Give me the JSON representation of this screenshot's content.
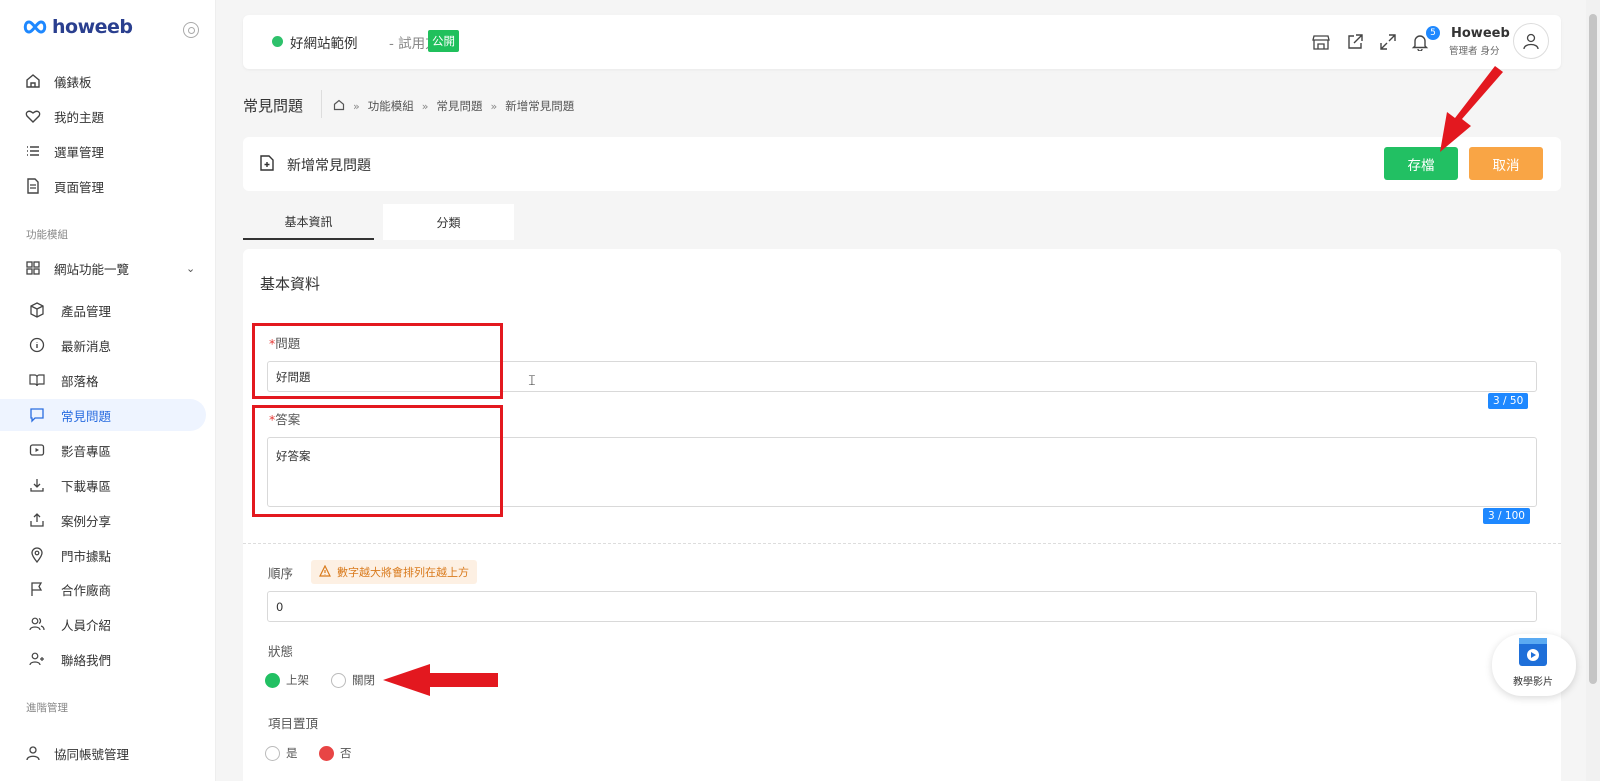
{
  "brand": {
    "logo_text": "howeeb"
  },
  "sidebar": {
    "top_items": [
      {
        "label": "儀錶板",
        "icon": "home-icon"
      },
      {
        "label": "我的主題",
        "icon": "heart-icon"
      },
      {
        "label": "選單管理",
        "icon": "list-icon"
      },
      {
        "label": "頁面管理",
        "icon": "document-icon"
      }
    ],
    "section_modules": "功能模組",
    "modules_group": {
      "label": "網站功能一覽",
      "icon": "grid-icon"
    },
    "module_items": [
      {
        "label": "產品管理",
        "icon": "box-icon"
      },
      {
        "label": "最新消息",
        "icon": "info-icon"
      },
      {
        "label": "部落格",
        "icon": "book-icon"
      },
      {
        "label": "常見問題",
        "icon": "chat-icon",
        "active": true
      },
      {
        "label": "影音專區",
        "icon": "video-icon"
      },
      {
        "label": "下載專區",
        "icon": "download-icon"
      },
      {
        "label": "案例分享",
        "icon": "share-icon"
      },
      {
        "label": "門市據點",
        "icon": "location-icon"
      },
      {
        "label": "合作廠商",
        "icon": "flag-icon"
      },
      {
        "label": "人員介紹",
        "icon": "users-icon"
      },
      {
        "label": "聯絡我們",
        "icon": "user-plus-icon"
      }
    ],
    "section_advanced": "進階管理",
    "advanced_items": [
      {
        "label": "協同帳號管理",
        "icon": "user-icon"
      }
    ]
  },
  "topbar": {
    "site_name": "好網站範例",
    "site_plan": "- 試用方案",
    "public_badge": "公開",
    "notification_count": "5",
    "user_name": "Howeeb",
    "user_role": "管理者 身分"
  },
  "breadcrumb": {
    "page_title": "常見問題",
    "items": [
      "功能模組",
      "常見問題",
      "新增常見問題"
    ],
    "sep": "»"
  },
  "form_header": {
    "title": "新增常見問題",
    "save_label": "存檔",
    "cancel_label": "取消"
  },
  "tabs": {
    "basic": "基本資訊",
    "category": "分類"
  },
  "form": {
    "heading": "基本資料",
    "required_mark": "*",
    "question_label": "問題",
    "question_value": "好問題",
    "question_counter": "3 / 50",
    "answer_label": "答案",
    "answer_value": "好答案",
    "answer_counter": "3 / 100",
    "order_label": "順序",
    "order_hint": "數字越大將會排列在越上方",
    "order_value": "0",
    "status_label": "狀態",
    "status_on": "上架",
    "status_off": "關閉",
    "pin_label": "項目置頂",
    "pin_yes": "是",
    "pin_no": "否"
  },
  "video_widget": {
    "label": "教學影片"
  },
  "colors": {
    "primary_green": "#22c063",
    "cancel_orange": "#f9a545",
    "accent_blue": "#1e88ff",
    "annotation_red": "#e3181f"
  }
}
